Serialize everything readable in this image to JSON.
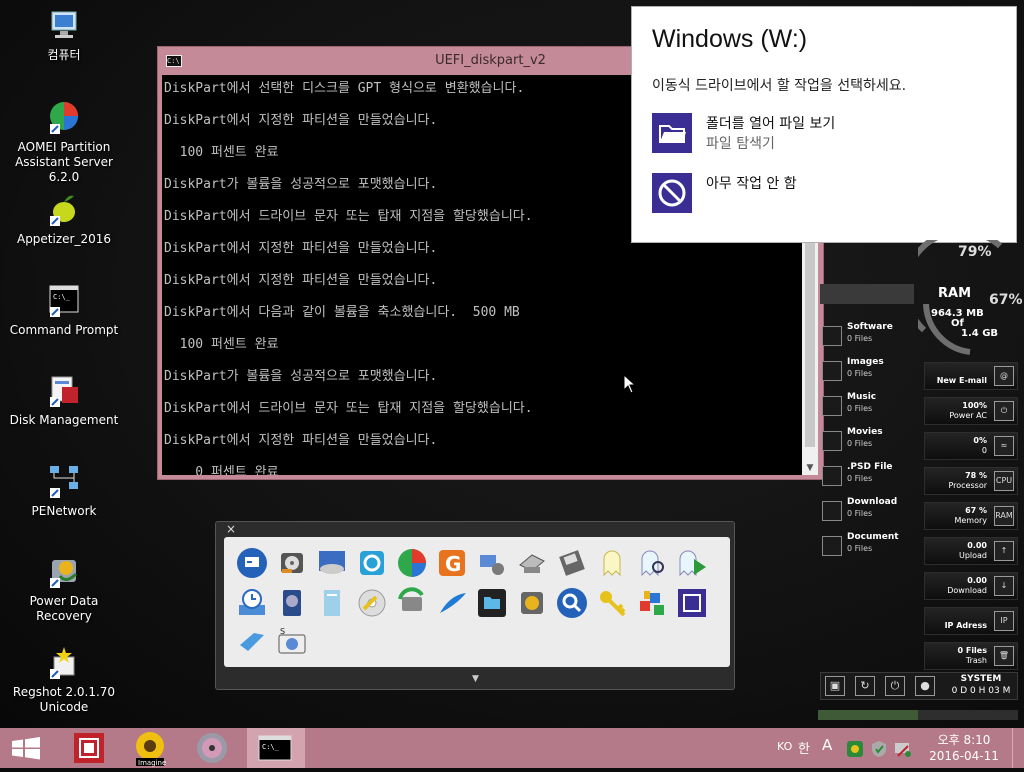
{
  "desktop_icons": [
    {
      "label": "컴퓨터",
      "icon": "computer-icon"
    },
    {
      "label": "AOMEI Partition Assistant Server 6.2.0",
      "icon": "aomei-icon"
    },
    {
      "label": "Appetizer_2016",
      "icon": "appetizer-icon"
    },
    {
      "label": "Command Prompt",
      "icon": "cmd-icon"
    },
    {
      "label": "Disk Management",
      "icon": "disk-management-icon"
    },
    {
      "label": "PENetwork",
      "icon": "network-icon"
    },
    {
      "label": "Power Data Recovery",
      "icon": "recovery-icon"
    },
    {
      "label": "Regshot 2.0.1.70 Unicode",
      "icon": "regshot-icon"
    }
  ],
  "console": {
    "title": "UEFI_diskpart_v2",
    "lines": [
      "DiskPart에서 선택한 디스크를 GPT 형식으로 변환했습니다.",
      "DiskPart에서 지정한 파티션을 만들었습니다.",
      "  100 퍼센트 완료",
      "DiskPart가 볼륨을 성공적으로 포맷했습니다.",
      "DiskPart에서 드라이브 문자 또는 탑재 지점을 할당했습니다.",
      "DiskPart에서 지정한 파티션을 만들었습니다.",
      "DiskPart에서 지정한 파티션을 만들었습니다.",
      "DiskPart에서 다음과 같이 볼륨을 축소했습니다.  500 MB",
      "  100 퍼센트 완료",
      "DiskPart가 볼륨을 성공적으로 포맷했습니다.",
      "DiskPart에서 드라이브 문자 또는 탑재 지점을 할당했습니다.",
      "DiskPart에서 지정한 파티션을 만들었습니다.",
      "    0 퍼센트 완료"
    ]
  },
  "notification": {
    "title": "Windows (W:)",
    "subtitle": "이동식 드라이브에서 할 작업을 선택하세요.",
    "options": [
      {
        "title": "폴더를 열어 파일 보기",
        "subtitle": "파일 탐색기",
        "icon": "folder-open-icon"
      },
      {
        "title": "아무 작업 안 함",
        "subtitle": "",
        "icon": "no-action-icon"
      }
    ]
  },
  "launcher": {
    "close": "×",
    "expand": "▼",
    "icons": [
      "remote-icon",
      "harddisk-icon",
      "scanner-icon",
      "box-icon",
      "partition-icon",
      "g-icon",
      "network-tool-icon",
      "drive-icon",
      "floppy-icon",
      "ghost-icon",
      "ghost-search-icon",
      "ghost-play-icon",
      "time-machine-icon",
      "hdd-icon",
      "files-icon",
      "cd-key-icon",
      "sync-icon",
      "feather-icon",
      "folder-icon",
      "hdd-tune-icon",
      "search-icon",
      "key-icon",
      "cube-icon",
      "chip-icon",
      "magnet-icon",
      "screenshot-icon"
    ]
  },
  "panel": {
    "gauge_top": "79%",
    "ram_label": "RAM",
    "ram_used": "964.3 MB",
    "ram_of": "Of",
    "ram_total": "1.4 GB",
    "ram_percent": "67%",
    "categories": [
      {
        "name": "Software",
        "count": "0 Files"
      },
      {
        "name": "Images",
        "count": "0 Files"
      },
      {
        "name": "Music",
        "count": "0 Files"
      },
      {
        "name": "Movies",
        "count": "0 Files"
      },
      {
        "name": ".PSD File",
        "count": "0 Files"
      },
      {
        "name": "Download",
        "count": "0 Files"
      },
      {
        "name": "Document",
        "count": "0 Files"
      }
    ],
    "stats": [
      {
        "l1": "New E-mail",
        "l2": "",
        "icon": "@"
      },
      {
        "l1": "100%",
        "l2": "Power AC",
        "icon": "⏻"
      },
      {
        "l1": "0%",
        "l2": "0",
        "icon": "≈"
      },
      {
        "l1": "78 %",
        "l2": "Processor",
        "icon": "CPU"
      },
      {
        "l1": "67 %",
        "l2": "Memory",
        "icon": "RAM"
      },
      {
        "l1": "0.00",
        "l2": "Upload",
        "icon": "↑"
      },
      {
        "l1": "0.00",
        "l2": "Download",
        "icon": "↓"
      },
      {
        "l1": "IP Adress",
        "l2": "",
        "icon": "IP"
      },
      {
        "l1": "0 Files",
        "l2": "Trash",
        "icon": "🗑"
      }
    ],
    "system_label": "SYSTEM",
    "system_uptime": "0 D 0 H 03 M"
  },
  "taskbar": {
    "lang": "KO",
    "ime": "한",
    "ime2": "A",
    "time": "오후 8:10",
    "date": "2016-04-11"
  },
  "colors": {
    "accent": "#3a2d93",
    "taskbar": "#b47a89",
    "window_frame": "#c48a97"
  }
}
